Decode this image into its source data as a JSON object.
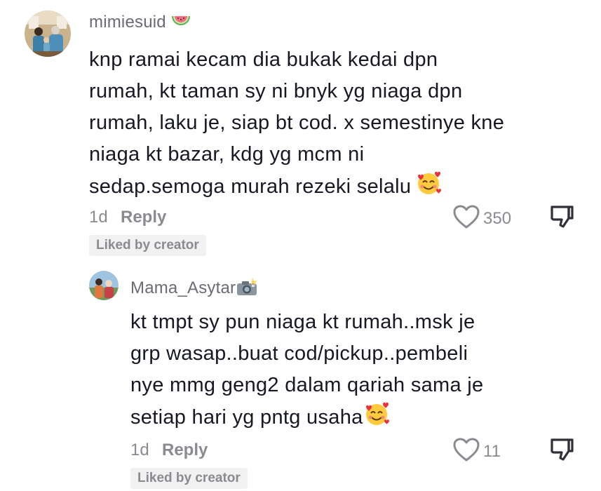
{
  "comments": [
    {
      "username": "mimiesuid",
      "username_badge_icon": "watermelon-icon",
      "lines": [
        "knp ramai kecam dia bukak kedai dpn",
        "rumah, kt taman sy ni bnyk yg niaga dpn",
        "rumah, laku je, siap bt cod. x semestinye kne",
        "niaga kt bazar, kdg yg mcm ni",
        "sedap.semoga murah rezeki selalu"
      ],
      "trailing_emoji_icon": "smiling-face-with-hearts-icon",
      "time": "1d",
      "reply_label": "Reply",
      "like_count": "350",
      "liked_by_label": "Liked by creator"
    },
    {
      "username": "Mama_Asytar",
      "username_badge_icon": "camera-flash-icon",
      "lines": [
        "kt tmpt sy pun niaga kt rumah..msk je",
        "grp wasap..buat cod/pickup..pembeli",
        "nye mmg geng2 dalam qariah sama je",
        "setiap hari yg pntg usaha"
      ],
      "trailing_emoji_icon": "smiling-face-with-hearts-icon",
      "time": "1d",
      "reply_label": "Reply",
      "like_count": "11",
      "liked_by_label": "Liked by creator"
    }
  ],
  "colors": {
    "text": "#161823",
    "muted": "#8a8b91",
    "username": "#6b6c73",
    "badge_bg": "#f1f1f2"
  }
}
